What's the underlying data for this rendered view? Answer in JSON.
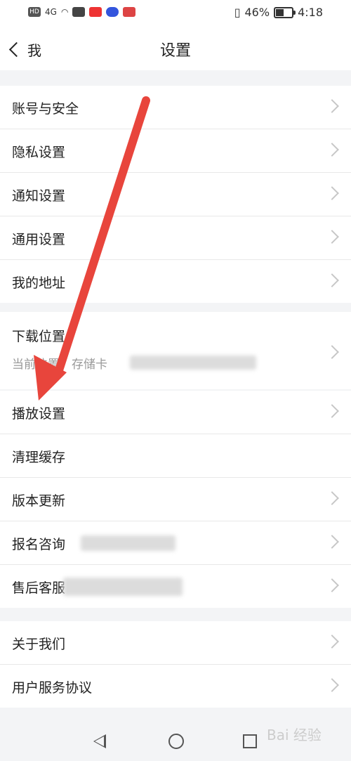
{
  "status": {
    "left_icons": [
      "HD",
      "4G",
      "wifi-icon",
      "app-icon",
      "app-icon",
      "app-icon",
      "app-icon"
    ],
    "battery_percent": "46%",
    "time": "4:18",
    "battery_level": 0.46
  },
  "nav": {
    "back_label": "我",
    "title": "设置"
  },
  "group1": [
    {
      "label": "账号与安全"
    },
    {
      "label": "隐私设置"
    },
    {
      "label": "通知设置"
    },
    {
      "label": "通用设置"
    },
    {
      "label": "我的地址"
    }
  ],
  "download": {
    "label": "下载位置",
    "sub": "当前位置：存储卡"
  },
  "group3": [
    {
      "label": "播放设置"
    },
    {
      "label": "清理缓存"
    },
    {
      "label": "版本更新"
    },
    {
      "label": "报名咨询"
    },
    {
      "label": "售后客服"
    }
  ],
  "group4": [
    {
      "label": "关于我们"
    },
    {
      "label": "用户服务协议"
    }
  ],
  "watermark": "Bai 经验",
  "colors": {
    "arrow": "#e8453c",
    "background": "#f3f4f6",
    "chevron": "#c7c7c7"
  }
}
